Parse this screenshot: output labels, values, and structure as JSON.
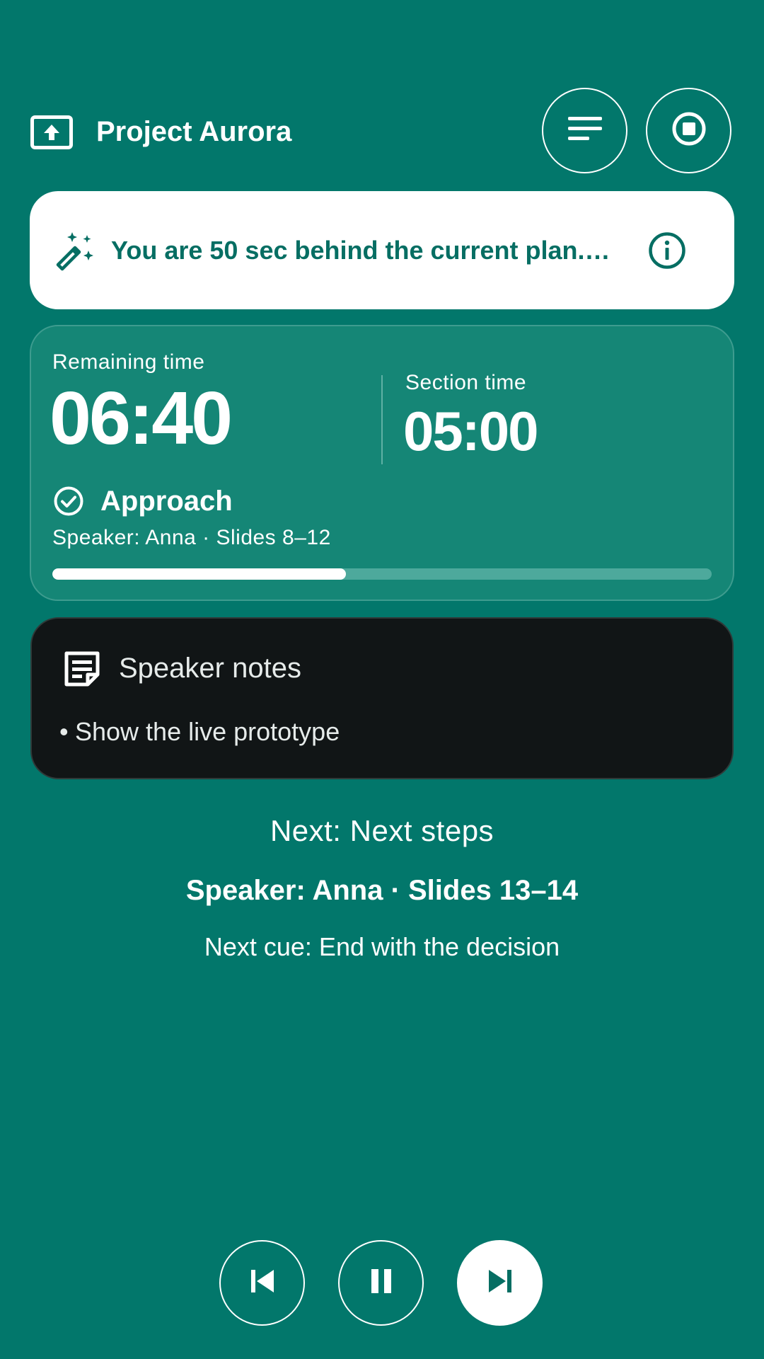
{
  "header": {
    "title": "Project Aurora",
    "icons": {
      "app": "present-to-all-icon",
      "menu": "notes-list-icon",
      "stop": "stop-circle-icon"
    }
  },
  "alert": {
    "text": "You are 50 sec behind the current plan. …",
    "icons": {
      "lead": "auto-fix-wand-icon",
      "trail": "info-icon"
    }
  },
  "timer": {
    "remaining_label": "Remaining time",
    "remaining_value": "06:40",
    "section_label": "Section time",
    "section_value": "05:00"
  },
  "current_section": {
    "name": "Approach",
    "meta": "Speaker: Anna · Slides 8–12",
    "progress_fraction": 0.445,
    "icon": "check-circle-icon"
  },
  "notes": {
    "title": "Speaker notes",
    "items": [
      "Show the live prototype"
    ],
    "icon": "sticky-note-icon"
  },
  "next": {
    "title": "Next: Next steps",
    "speaker": "Speaker: Anna · Slides 13–14",
    "cue": "Next cue: End with the decision"
  },
  "controls": {
    "icons": {
      "previous": "skip-previous-icon",
      "pause": "pause-icon",
      "next": "skip-next-icon"
    }
  },
  "colors": {
    "background": "#02776b",
    "card": "#158676",
    "notes_background": "#111516",
    "accent_text": "#066e63",
    "white": "#ffffff"
  }
}
